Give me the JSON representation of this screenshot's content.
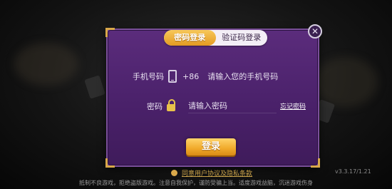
{
  "tabs": [
    {
      "label": "密码登录",
      "active": true
    },
    {
      "label": "验证码登录",
      "active": false
    }
  ],
  "phone": {
    "label": "手机号码",
    "icon": "phone-icon",
    "prefix": "+86",
    "placeholder": "请输入您的手机号码"
  },
  "password": {
    "label": "密码",
    "icon": "lock-icon",
    "placeholder": "请输入密码",
    "forgot_link": "忘记密码"
  },
  "login_button": "登录",
  "close_icon": "close-icon",
  "agreement": "同意用户协议及隐私条款",
  "version": "v3.3.17/1.21",
  "notice": "抵制不良游戏，拒绝盗版游戏。注意自我保护，谨防受骗上当。适度游戏益脑，沉迷游戏伤身",
  "colors": {
    "dialog_bg": "#4a216a",
    "accent": "#f0a92a",
    "corner": "#d9a84a"
  }
}
